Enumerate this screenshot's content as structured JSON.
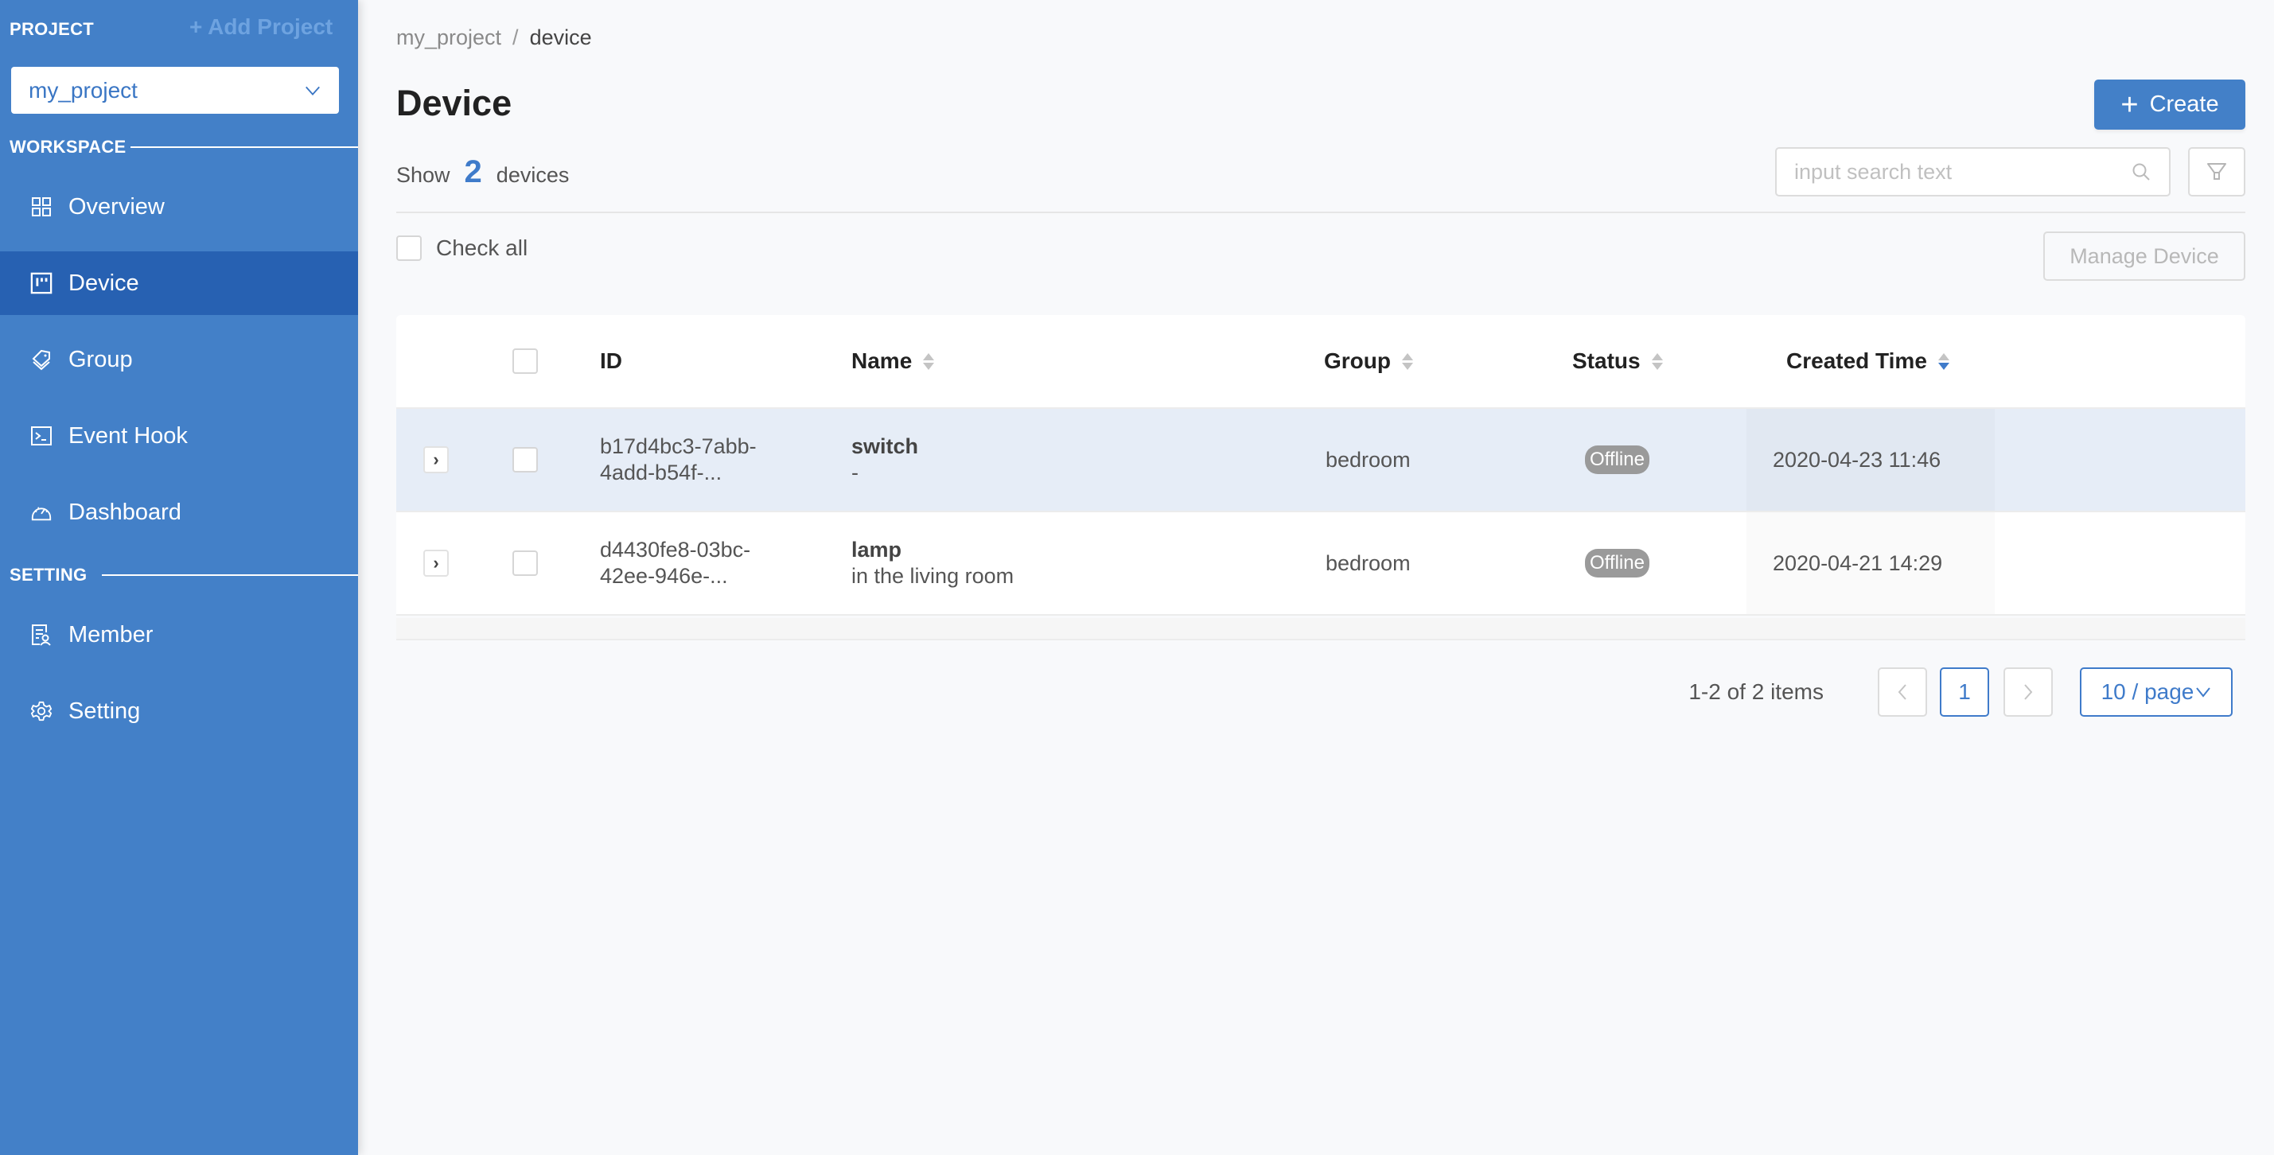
{
  "sidebar": {
    "project_label": "PROJECT",
    "add_project_label": "+ Add Project",
    "project_select": {
      "value": "my_project"
    },
    "workspace_label": "WORKSPACE",
    "setting_label": "SETTING",
    "workspace_items": [
      {
        "label": "Overview",
        "icon": "grid-icon",
        "active": false
      },
      {
        "label": "Device",
        "icon": "device-icon",
        "active": true
      },
      {
        "label": "Group",
        "icon": "tags-icon",
        "active": false
      },
      {
        "label": "Event Hook",
        "icon": "terminal-icon",
        "active": false
      },
      {
        "label": "Dashboard",
        "icon": "dashboard-gauge-icon",
        "active": false
      }
    ],
    "setting_items": [
      {
        "label": "Member",
        "icon": "member-icon",
        "active": false
      },
      {
        "label": "Setting",
        "icon": "gear-icon",
        "active": false
      }
    ]
  },
  "header": {
    "breadcrumb": [
      "my_project",
      "device"
    ],
    "breadcrumb_separator": "/",
    "title": "Device",
    "show_prefix": "Show",
    "device_count": "2",
    "show_suffix": "devices",
    "create_label": "Create",
    "search_placeholder": "input search text",
    "search_value": "",
    "check_all_label": "Check all",
    "manage_device_label": "Manage Device"
  },
  "table": {
    "columns": [
      {
        "label": "ID",
        "sortable": false
      },
      {
        "label": "Name",
        "sortable": true,
        "sort": "none"
      },
      {
        "label": "Group",
        "sortable": true,
        "sort": "none"
      },
      {
        "label": "Status",
        "sortable": true,
        "sort": "none"
      },
      {
        "label": "Created Time",
        "sortable": true,
        "sort": "descend"
      }
    ],
    "rows": [
      {
        "id_line1": "b17d4bc3-7abb-",
        "id_line2": "4add-b54f-...",
        "name": "switch",
        "description": "-",
        "group": "bedroom",
        "status": "Offline",
        "created_time": "2020-04-23 11:46"
      },
      {
        "id_line1": "d4430fe8-03bc-",
        "id_line2": "42ee-946e-...",
        "name": "lamp",
        "description": "in the living room",
        "group": "bedroom",
        "status": "Offline",
        "created_time": "2020-04-21 14:29"
      }
    ]
  },
  "pagination": {
    "total_text": "1-2 of 2 items",
    "current_page": "1",
    "prev_symbol": "<",
    "next_symbol": ">",
    "page_size_label": "10 / page"
  },
  "colors": {
    "sidebar_bg": "#4380c8",
    "sidebar_active": "#2761b2",
    "accent": "#3f7bca",
    "status_offline": "#9a9a9a"
  }
}
